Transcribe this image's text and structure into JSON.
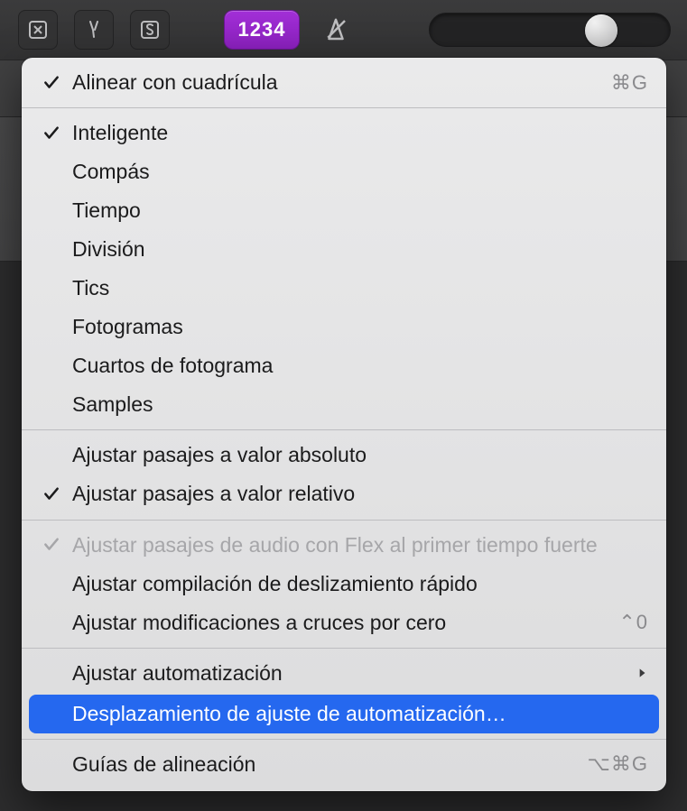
{
  "toolbar": {
    "badge_text": "1234"
  },
  "menu": {
    "items": [
      {
        "label": "Alinear con cuadrícula",
        "checked": true,
        "shortcut": "⌘G"
      },
      {
        "sep": true
      },
      {
        "label": "Inteligente",
        "checked": true
      },
      {
        "label": "Compás"
      },
      {
        "label": "Tiempo"
      },
      {
        "label": "División"
      },
      {
        "label": "Tics"
      },
      {
        "label": "Fotogramas"
      },
      {
        "label": "Cuartos de fotograma"
      },
      {
        "label": "Samples"
      },
      {
        "sep": true
      },
      {
        "label": "Ajustar pasajes a valor absoluto"
      },
      {
        "label": "Ajustar pasajes a valor relativo",
        "checked": true
      },
      {
        "sep": true
      },
      {
        "label": "Ajustar pasajes de audio con Flex al primer tiempo fuerte",
        "checked": true,
        "disabled": true
      },
      {
        "label": "Ajustar compilación de deslizamiento rápido"
      },
      {
        "label": "Ajustar modificaciones a cruces por cero",
        "shortcut": "⌃0"
      },
      {
        "sep": true
      },
      {
        "label": "Ajustar automatización",
        "submenu": true
      },
      {
        "label": "Desplazamiento de ajuste de automatización…",
        "highlight": true
      },
      {
        "sep": true
      },
      {
        "label": "Guías de alineación",
        "shortcut": "⌥⌘G"
      }
    ]
  }
}
